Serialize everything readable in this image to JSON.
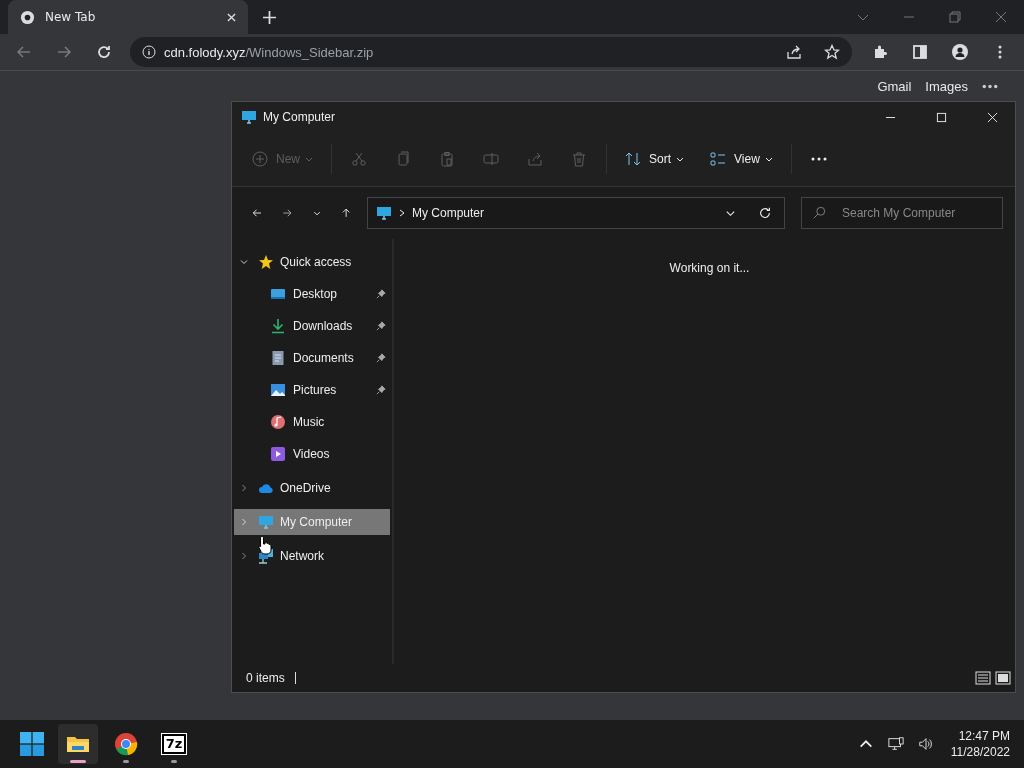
{
  "browser": {
    "tab": {
      "title": "New Tab"
    },
    "address": {
      "host": "cdn.folody.xyz",
      "path": "/Windows_Sidebar.zip"
    },
    "top_links": [
      "Gmail",
      "Images"
    ]
  },
  "explorer": {
    "title": "My Computer",
    "toolbar": [
      {
        "kind": "new",
        "label": "New",
        "disabled": true
      },
      {
        "kind": "icon",
        "disabled": true
      },
      {
        "kind": "icon",
        "disabled": true
      },
      {
        "kind": "icon",
        "disabled": true
      },
      {
        "kind": "icon",
        "disabled": true
      },
      {
        "kind": "icon",
        "disabled": true
      },
      {
        "kind": "icon",
        "disabled": true
      },
      {
        "kind": "menu",
        "label": "Sort",
        "disabled": false
      },
      {
        "kind": "menu",
        "label": "View",
        "disabled": false
      },
      {
        "kind": "more"
      }
    ],
    "breadcrumb": [
      "My Computer"
    ],
    "search": {
      "placeholder": "Search My Computer"
    },
    "sidebar": [
      {
        "label": "Quick access",
        "expanded": true,
        "selected": false,
        "children": [
          {
            "label": "Desktop",
            "pinned": true,
            "selected": false
          },
          {
            "label": "Downloads",
            "pinned": true,
            "selected": false
          },
          {
            "label": "Documents",
            "pinned": true,
            "selected": false
          },
          {
            "label": "Pictures",
            "pinned": true,
            "selected": false
          },
          {
            "label": "Music",
            "pinned": false,
            "selected": false
          },
          {
            "label": "Videos",
            "pinned": false,
            "selected": false
          }
        ]
      },
      {
        "label": "OneDrive",
        "expanded": false,
        "selected": false
      },
      {
        "label": "My Computer",
        "expanded": false,
        "selected": true
      },
      {
        "label": "Network",
        "expanded": false,
        "selected": false
      }
    ],
    "message": "Working on it...",
    "status": "0 items"
  },
  "taskbar": {
    "apps": [
      {
        "kind": "folder",
        "active": true
      },
      {
        "kind": "browser",
        "active": false
      },
      {
        "kind": "badge",
        "label": "7z",
        "active": false
      }
    ],
    "time": "12:47 PM",
    "date": "11/28/2022"
  }
}
